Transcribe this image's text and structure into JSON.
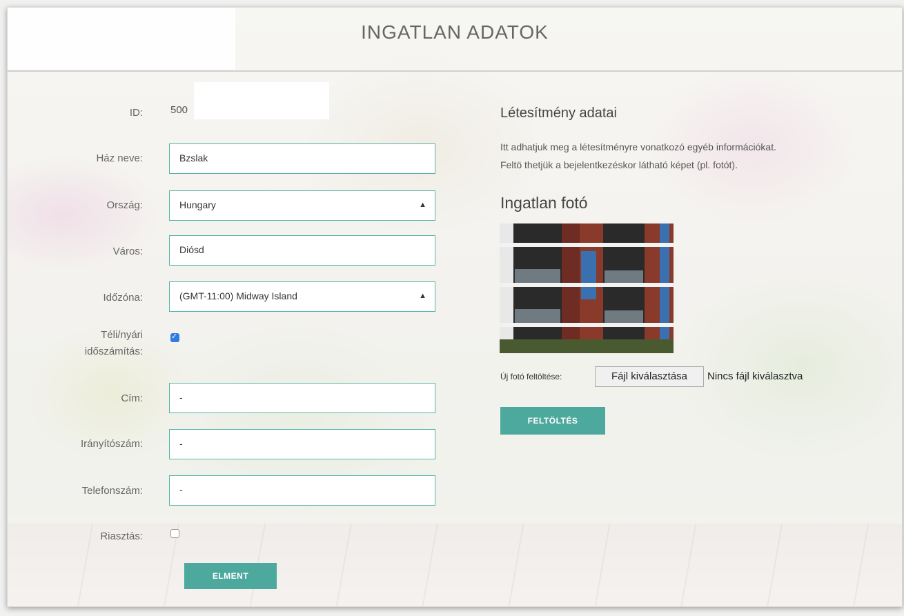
{
  "header": {
    "title": "INGATLAN ADATOK"
  },
  "form": {
    "id": {
      "label": "ID:",
      "value": "500"
    },
    "house_name": {
      "label": "Ház neve:",
      "value": "Bzslak"
    },
    "country": {
      "label": "Ország:",
      "value": "Hungary"
    },
    "city": {
      "label": "Város:",
      "value": "Diósd"
    },
    "timezone": {
      "label": "Időzóna:",
      "value": "(GMT-11:00) Midway Island"
    },
    "dst": {
      "label_line1": "Téli/nyári",
      "label_line2": "időszámítás:",
      "checked": true
    },
    "address": {
      "label": "Cím:",
      "value": "-"
    },
    "zip": {
      "label": "Irányítószám:",
      "value": "-"
    },
    "phone": {
      "label": "Telefonszám:",
      "value": "-"
    },
    "alarm": {
      "label": "Riasztás:",
      "checked": false
    },
    "save_label": "ELMENT"
  },
  "facility": {
    "heading": "Létesítmény adatai",
    "description_line1": "Itt adhatjuk meg a létesítményre vonatkozó egyéb információkat.",
    "description_line2": "Feltö thetjük a bejelentkezéskor látható képet (pl. fotót).",
    "photo_heading": "Ingatlan fotó",
    "upload_label": "Új fotó feltöltése:",
    "file_button": "Fájl kiválasztása",
    "file_status": "Nincs fájl kiválasztva",
    "upload_button": "FELTÖLTÉS"
  },
  "colors": {
    "accent": "#4da99d",
    "checkbox": "#2f7de1"
  }
}
